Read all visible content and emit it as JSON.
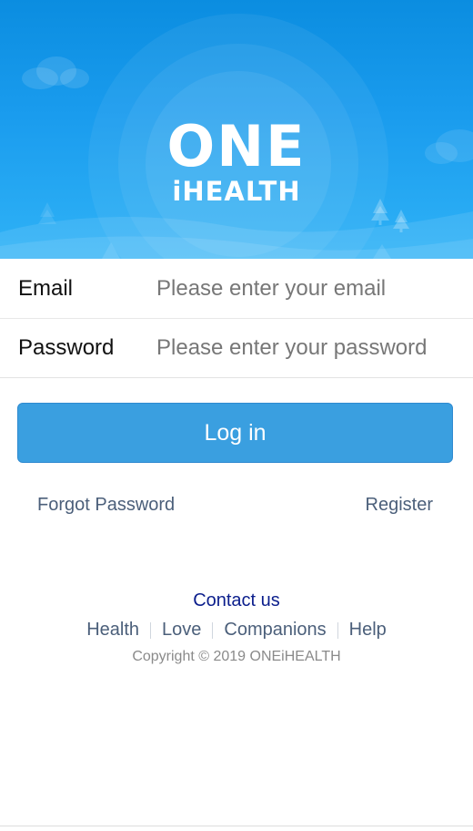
{
  "brand": {
    "logo_top": "ONE",
    "logo_bottom": "iHEALTH"
  },
  "form": {
    "email_label": "Email",
    "email_placeholder": "Please enter your email",
    "email_value": "",
    "password_label": "Password",
    "password_placeholder": "Please enter your password",
    "password_value": ""
  },
  "actions": {
    "login_label": "Log in",
    "forgot_label": "Forgot Password",
    "register_label": "Register"
  },
  "footer": {
    "contact_label": "Contact us",
    "links": [
      "Health",
      "Love",
      "Companions",
      "Help"
    ],
    "copyright": "Copyright © 2019 ONEiHEALTH"
  },
  "colors": {
    "banner_blue": "#1a9cee",
    "button_blue": "#3a9fe0",
    "link_gray_blue": "#4b5f7a",
    "contact_navy": "#0b1e8c"
  }
}
